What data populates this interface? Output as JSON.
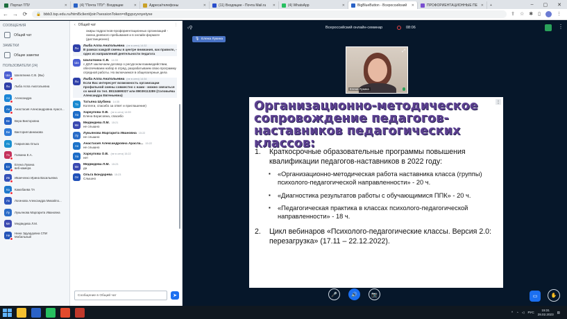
{
  "browser": {
    "tabs": [
      {
        "label": "Портал ТПУ",
        "color": "#1f6f3f"
      },
      {
        "label": "(4) \"Почта ТПУ\": Входящие",
        "color": "#2a62c6"
      },
      {
        "label": "Адреса/телефоны",
        "color": "#c9a129"
      },
      {
        "label": "(11) Входящие - Почта Mail.ru",
        "color": "#2a4ecb"
      },
      {
        "label": "(4) WhatsApp",
        "color": "#27c060"
      },
      {
        "label": "BigBlueButton - Всероссийский",
        "color": "#2a62c6",
        "active": true
      },
      {
        "label": "ПРОФОРИЕНТАЦИОННЫЕ ПЕ",
        "color": "#7a4fd0"
      }
    ],
    "new_tab": "+",
    "url": "bbb3.tsp.edu.ru/html5client/join?sessionToken=r8gypzyxnyetyxe"
  },
  "users_panel": {
    "messages_title": "СООБЩЕНИЯ",
    "public_chat": "Общий чат",
    "notes_title": "ЗАМЕТКИ",
    "shared_notes": "Общие заметки",
    "users_title": "ПОЛЬЗОВАТЕЛИ (24)",
    "users": [
      {
        "initials": "Ша",
        "name": "Шалаткина С.В. (Вы)",
        "color": "#4a5ed2",
        "mic": true
      },
      {
        "initials": "Лы",
        "name": "Лыба Алла Анатольевна",
        "color": "#2e3fa8",
        "mic": false
      },
      {
        "initials": "Ал",
        "name": "Александра",
        "color": "#1b86d6",
        "mic": true
      },
      {
        "initials": "Ан",
        "name": "Анастасия Александровна Арасл...",
        "color": "#1e73c9",
        "mic": true
      },
      {
        "initials": "Ве",
        "name": "Вера Викторовна",
        "color": "#2664c8",
        "mic": false
      },
      {
        "initials": "Ви",
        "name": "Виктория Шинакова",
        "color": "#2f7bd8",
        "mic": false
      },
      {
        "initials": "Га",
        "name": "Гаврилова Ольга",
        "color": "#1a8fd0",
        "mic": false
      },
      {
        "initials": "Га",
        "name": "Галкина Е.А.",
        "color": "#c4315b",
        "mic": true
      },
      {
        "initials": "Ел",
        "name": "Елена Лукина\nвеб-камера",
        "color": "#1e5fc0",
        "mic": true
      },
      {
        "initials": "Ив",
        "name": "Иванченко Ирина Васильевна",
        "color": "#3451b8",
        "mic": true
      },
      {
        "initials": "Ка",
        "name": "Камобаева ТА",
        "color": "#1f79cc",
        "mic": true
      },
      {
        "initials": "Ло",
        "name": "Логинова Александра Михайло...",
        "color": "#2d57bd",
        "mic": false
      },
      {
        "initials": "Лу",
        "name": "Лукьянова Маргарита Ивановна",
        "color": "#2a6cc8",
        "mic": false
      },
      {
        "initials": "Ме",
        "name": "Медведева Л.М.",
        "color": "#3b49b0",
        "mic": false
      },
      {
        "initials": "Ни",
        "name": "Нина Эдуардовна СПИ\nМобильный",
        "color": "#2555b8",
        "mic": true
      }
    ]
  },
  "chat": {
    "back": "‹",
    "title": "Общий чат",
    "more": "⋮",
    "continuation": "окиры подростков-профориентационных организаций - смена дневного пребывания и в онлайн-формате (дистанционно)",
    "messages": [
      {
        "initials": "Лы",
        "name": "Лыба Алла Анатольевна",
        "meta": "(не в сети) 14:32",
        "color": "#2e3fa8",
        "text": "В рамках каждой смены в центре внимания, как правило, - одно из направлений деятельности педагога",
        "bold": true,
        "hl": true
      },
      {
        "initials": "Ша",
        "name": "Шалаткина С.В.",
        "meta": "14:33",
        "color": "#4a5ed2",
        "text": "с ДОЛ заключаем договор о ресурсном взаимодействии, обеспечиваем набор в отряд, разрабатываем свою программу отрядной работы. Но включаемся в общелагерные дела",
        "bold": false,
        "hl": false
      },
      {
        "initials": "Лы",
        "name": "Лыба Алла Анатольевна",
        "meta": "(не в сети) 14:34",
        "color": "#2e3fa8",
        "text": "Если Вас интересует возможность организации профильной смены совместно с нами - можно связаться со мной по тел. 89134699327 или 89039113289 (Соловьёва Александра Евгеньевна)",
        "bold": true,
        "hl": true
      },
      {
        "initials": "Та",
        "name": "Татьяна Шубина",
        "meta": "14:35",
        "color": "#1b8ad0",
        "text": "Коллеги, спасибо за ответ и приглашение)",
        "bold": false,
        "hl": false
      },
      {
        "initials": "Ха",
        "name": "Харкулова О.В.",
        "meta": "(не в сети) 14:59",
        "color": "#1e6dc8",
        "text": "Елена Борисовна, спасибо",
        "bold": false,
        "hl": false
      },
      {
        "initials": "Ме",
        "name": "Медведева Л.М.",
        "meta": "15:21",
        "color": "#3b49b0",
        "text": "не слышно",
        "bold": false,
        "hl": false
      },
      {
        "initials": "Лу",
        "name": "Лукьянова Маргарита Ивановна",
        "meta": "15:22",
        "color": "#2a6cc8",
        "text": "не слышно",
        "bold": false,
        "hl": false
      },
      {
        "initials": "Ан",
        "name": "Анастасия Александровна Арасла...",
        "meta": "15:22",
        "color": "#1e73c9",
        "text": "не слышно",
        "bold": false,
        "hl": false
      },
      {
        "initials": "Ха",
        "name": "Харкулова О.В.",
        "meta": "(не в сети) 15:22",
        "color": "#1e6dc8",
        "text": "нет",
        "bold": false,
        "hl": false
      },
      {
        "initials": "Ме",
        "name": "Медведева Л.М.",
        "meta": "15:23",
        "color": "#3b49b0",
        "text": "да",
        "bold": false,
        "hl": false
      },
      {
        "initials": "Ол",
        "name": "Ольга Бондарева",
        "meta": "15:23",
        "color": "#2050b8",
        "text": "Слышно",
        "bold": false,
        "hl": false
      }
    ],
    "input_placeholder": "Сообщение в Общий чат",
    "send": "➤"
  },
  "stage": {
    "back_icon": "‹⚲",
    "meeting_title": "Всероссийский онлайн-семинар",
    "rec_time": "08:06",
    "talking": "Елена Лукина",
    "video_name": "Елена Лукина",
    "slide": {
      "menu": "⋮",
      "title": "Организационно-методическое сопровождение педагогов-наставников педагогических классов:",
      "item1_num": "1.",
      "item1": "Краткосрочные образовательные программы повышения квалификации педагогов-наставников в 2022 году:",
      "subs": [
        "«Организационно-методическая работа наставника класса (группы) психолого-педагогической направленности» - 20 ч.",
        "«Диагностика результатов работы с обучающимися ППК» - 20 ч.",
        "«Педагогическая практика в классах психолого-педагогической направленности» - 18 ч."
      ],
      "bullet": "▪",
      "item2_num": "2.",
      "item2": "Цикл вебинаров «Психолого-педагогические классы. Версия 2.0: перезагрузка» (17.11 – 22.12.2022)."
    }
  },
  "taskbar": {
    "lang": "РУС",
    "time": "15:31",
    "date": "28.02.2023",
    "apps": [
      "#f5c030",
      "#2a62c6",
      "#27c060",
      "#e34b2d",
      "#c0392b"
    ]
  }
}
